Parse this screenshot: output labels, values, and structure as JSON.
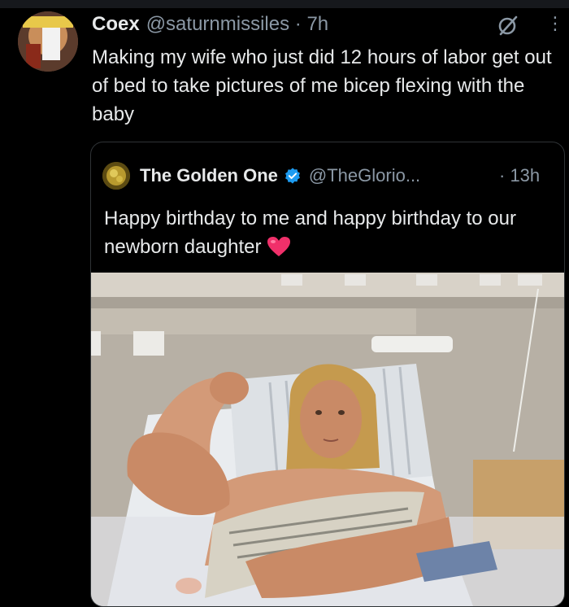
{
  "tweet": {
    "author_name": "Coex",
    "author_handle": "@saturnmissiles",
    "separator": "·",
    "time": "7h",
    "text": "Making my wife who just did 12 hours of labor get out of bed to take pictures of me bicep flexing with the baby"
  },
  "quoted_tweet": {
    "author_name": "The Golden One",
    "author_handle": "@TheGlorio...",
    "time": "· 13h",
    "text": "Happy birthday to me and happy birthday to our newborn daughter"
  },
  "icons": {
    "avatar": "profile-avatar",
    "grok": "grok-icon",
    "more": "more-options-icon",
    "verified": "verified-badge-icon",
    "heart": "heart-emoji-icon"
  },
  "colors": {
    "background": "#000000",
    "text": "#e7e9ea",
    "secondary": "#8b98a5",
    "verified_blue": "#1d9bf0",
    "heart": "#f0306a"
  }
}
